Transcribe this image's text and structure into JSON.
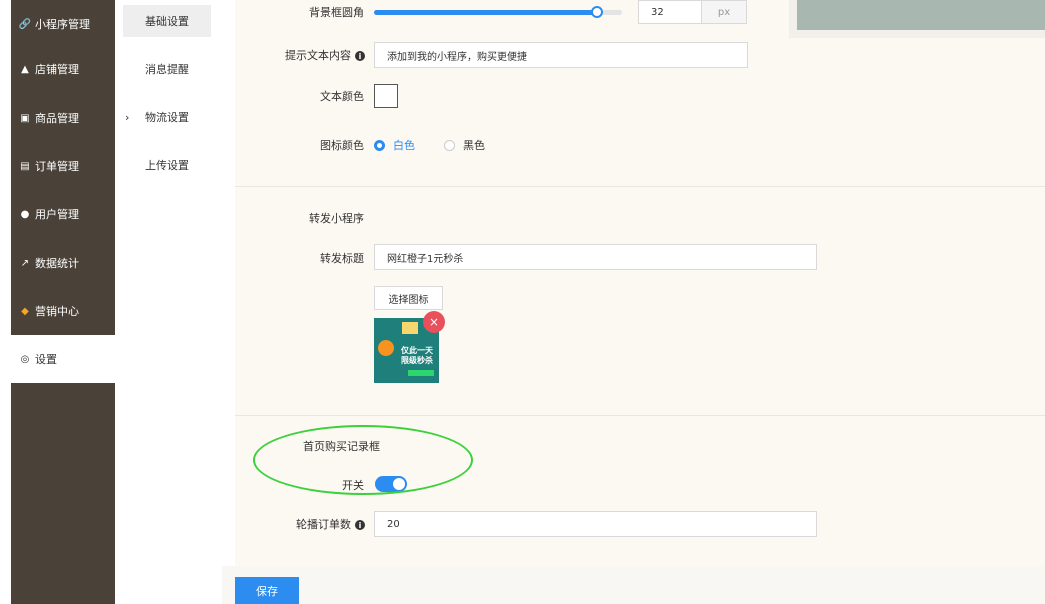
{
  "sidebar": {
    "items": [
      {
        "label": "小程序管理",
        "icon": "link-icon"
      },
      {
        "label": "店铺管理",
        "icon": "shop-icon"
      },
      {
        "label": "商品管理",
        "icon": "goods-icon"
      },
      {
        "label": "订单管理",
        "icon": "order-icon"
      },
      {
        "label": "用户管理",
        "icon": "user-icon"
      },
      {
        "label": "数据统计",
        "icon": "chart-icon"
      },
      {
        "label": "营销中心",
        "icon": "marketing-icon"
      },
      {
        "label": "设置",
        "icon": "gear-icon"
      }
    ]
  },
  "submenu": {
    "items": [
      {
        "label": "基础设置"
      },
      {
        "label": "消息提醒"
      },
      {
        "label": "物流设置"
      },
      {
        "label": "上传设置"
      }
    ]
  },
  "form": {
    "bg_radius_label": "背景框圆角",
    "bg_radius_value": "32",
    "bg_radius_unit": "px",
    "bg_radius_fraction": 0.9,
    "hint_text_label": "提示文本内容",
    "hint_text_value": "添加到我的小程序，购买更便捷",
    "text_color_label": "文本颜色",
    "icon_color_label": "图标颜色",
    "icon_color_white": "白色",
    "icon_color_black": "黑色",
    "share_section_title": "转发小程序",
    "share_title_label": "转发标题",
    "share_title_value": "网红橙子1元秒杀",
    "choose_icon_button": "选择图标",
    "thumb_line1": "仅此一天",
    "thumb_line2": "限级秒杀",
    "purchase_section_title": "首页购买记录框",
    "switch_label": "开关",
    "carousel_label": "轮播订单数",
    "carousel_value": "20"
  },
  "footer": {
    "save_label": "保存"
  },
  "colors": {
    "accent": "#2d8cf0",
    "sidebar_bg": "#4a4238",
    "annotation": "#3ad13a"
  }
}
